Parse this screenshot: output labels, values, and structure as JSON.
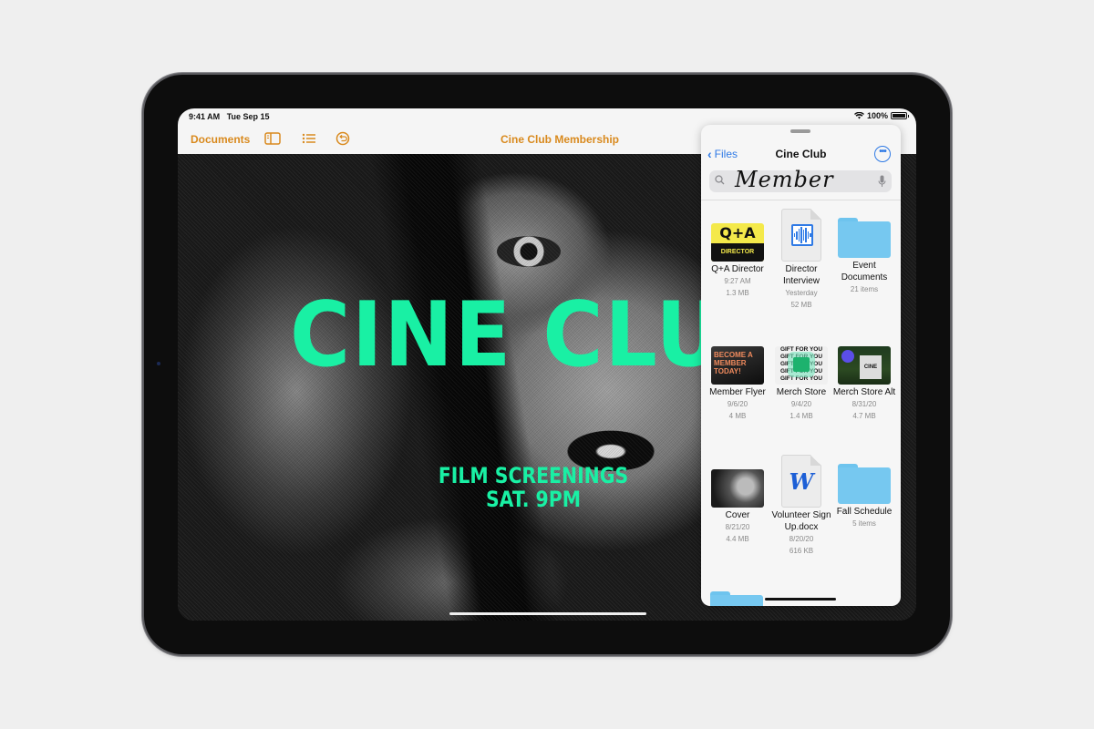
{
  "status_bar": {
    "time": "9:41 AM",
    "date": "Tue Sep 15",
    "battery": "100%",
    "battery_level": 1.0,
    "wifi_icon": "wifi-icon"
  },
  "toolbar": {
    "documents_label": "Documents",
    "icons": [
      "sidebar-icon",
      "list-icon",
      "undo-icon"
    ],
    "document_title": "Cine Club Membership",
    "accent_color": "#d98a1e"
  },
  "poster": {
    "title": "CINE CLUB",
    "subtitle_line1": "FILM SCREENINGS",
    "subtitle_line2": "SAT. 9PM",
    "text_color": "#19f0a4"
  },
  "files_panel": {
    "back_label": "Files",
    "title": "Cine Club",
    "more_icon": "ellipsis-circle-icon",
    "search": {
      "value": "Member",
      "placeholder": "Search"
    },
    "accent_color": "#2f7ae5",
    "items": [
      {
        "name": "Q+A Director",
        "line2": "9:27 AM",
        "line3": "1.3 MB",
        "kind": "image",
        "thumb_text_top": "Q+A",
        "thumb_text_bottom": "DIRECTOR"
      },
      {
        "name": "Director Interview",
        "line2": "Yesterday",
        "line3": "52 MB",
        "kind": "audio"
      },
      {
        "name": "Event Documents",
        "line2": "21 items",
        "line3": "",
        "kind": "folder"
      },
      {
        "name": "Member Flyer",
        "line2": "9/6/20",
        "line3": "4 MB",
        "kind": "image",
        "thumb_text": "BECOME A MEMBER TODAY!"
      },
      {
        "name": "Merch Store",
        "line2": "9/4/20",
        "line3": "1.4 MB",
        "kind": "image",
        "thumb_text": "GIFT FOR YOU GIFT FOR YOU GIFT FOR YOU GIFT FOR YOU GIFT FOR YOU"
      },
      {
        "name": "Merch Store Alt",
        "line2": "8/31/20",
        "line3": "4.7 MB",
        "kind": "image",
        "thumb_text": "CINE"
      },
      {
        "name": "Cover",
        "line2": "8/21/20",
        "line3": "4.4 MB",
        "kind": "image"
      },
      {
        "name": "Volunteer Sign Up.docx",
        "line2": "8/20/20",
        "line3": "616 KB",
        "kind": "word",
        "thumb_text": "W"
      },
      {
        "name": "Fall Schedule",
        "line2": "5 items",
        "line3": "",
        "kind": "folder"
      }
    ]
  }
}
